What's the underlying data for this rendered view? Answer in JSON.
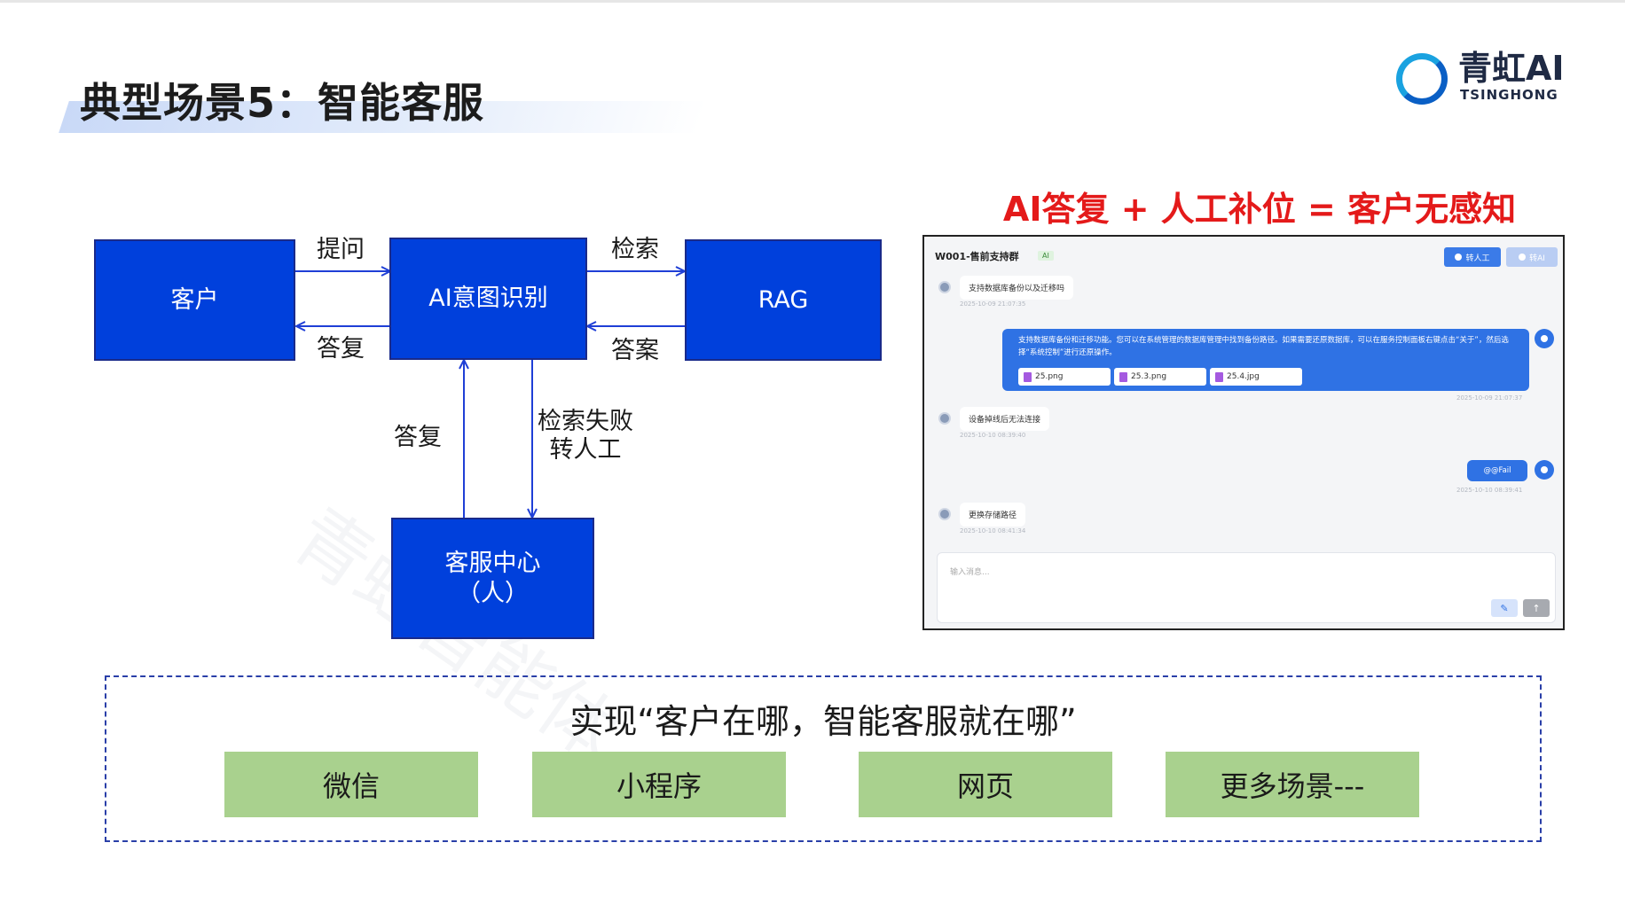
{
  "slide": {
    "title": "典型场景5：智能客服",
    "logo": {
      "cn": "青虹AI",
      "en": "TSINGHONG"
    },
    "watermark": "青虹智能体"
  },
  "diagram": {
    "nodes": {
      "customer": "客户",
      "intent": "AI意图识别",
      "rag": "RAG",
      "service_center": "客服中心\n（人）"
    },
    "edges": {
      "ask": "提问",
      "reply_top": "答复",
      "retrieve": "检索",
      "answer": "答案",
      "reply_left": "答复",
      "fail_transfer": "检索失败\n转人工"
    },
    "colors": {
      "node_fill": "#0040dc",
      "arrow": "#1f3fd6"
    }
  },
  "headline": "AI答复 + 人工补位 = 客户无感知",
  "chat": {
    "group_name": "W001-售前支持群",
    "tag": "AI",
    "buttons": {
      "transfer": "转人工",
      "ai": "转AI"
    },
    "messages": [
      {
        "side": "left",
        "text": "支持数据库备份以及迁移吗",
        "time": "2025-10-09 21:07:35"
      },
      {
        "side": "right",
        "text": "支持数据库备份和迁移功能。您可以在系统管理的数据库管理中找到备份路径。如果需要还原数据库，可以在服务控制面板右键点击“关于”，然后选择“系统控制”进行还原操作。",
        "files": [
          "25.png",
          "25.3.png",
          "25.4.jpg"
        ],
        "time": "2025-10-09 21:07:37"
      },
      {
        "side": "left",
        "text": "设备掉线后无法连接",
        "time": "2025-10-10 08:39:40"
      },
      {
        "side": "right",
        "text": "@@Fail",
        "time": "2025-10-10 08:39:41"
      },
      {
        "side": "left",
        "text": "更换存储路径",
        "time": "2025-10-10 08:41:34"
      }
    ],
    "input_placeholder": "输入消息..."
  },
  "bottom": {
    "slogan": "实现“客户在哪，智能客服就在哪”",
    "channels": [
      "微信",
      "小程序",
      "网页",
      "更多场景---"
    ]
  }
}
